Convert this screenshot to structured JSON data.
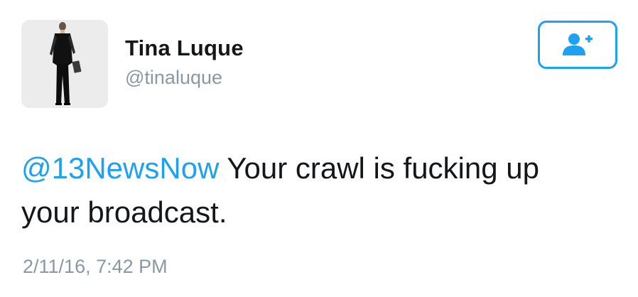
{
  "author": {
    "name": "Tina Luque",
    "handle": "@tinaluque"
  },
  "follow_button": {
    "icon": "add-user-icon",
    "accent_color": "#1da1f2"
  },
  "tweet": {
    "mention": "@13NewsNow",
    "text_line1": " Your crawl is fucking up",
    "text_line2": "your broadcast."
  },
  "timestamp": "2/11/16, 7:42 PM",
  "colors": {
    "text": "#14171a",
    "secondary_text": "#8899a6",
    "link": "#1da1f2"
  }
}
